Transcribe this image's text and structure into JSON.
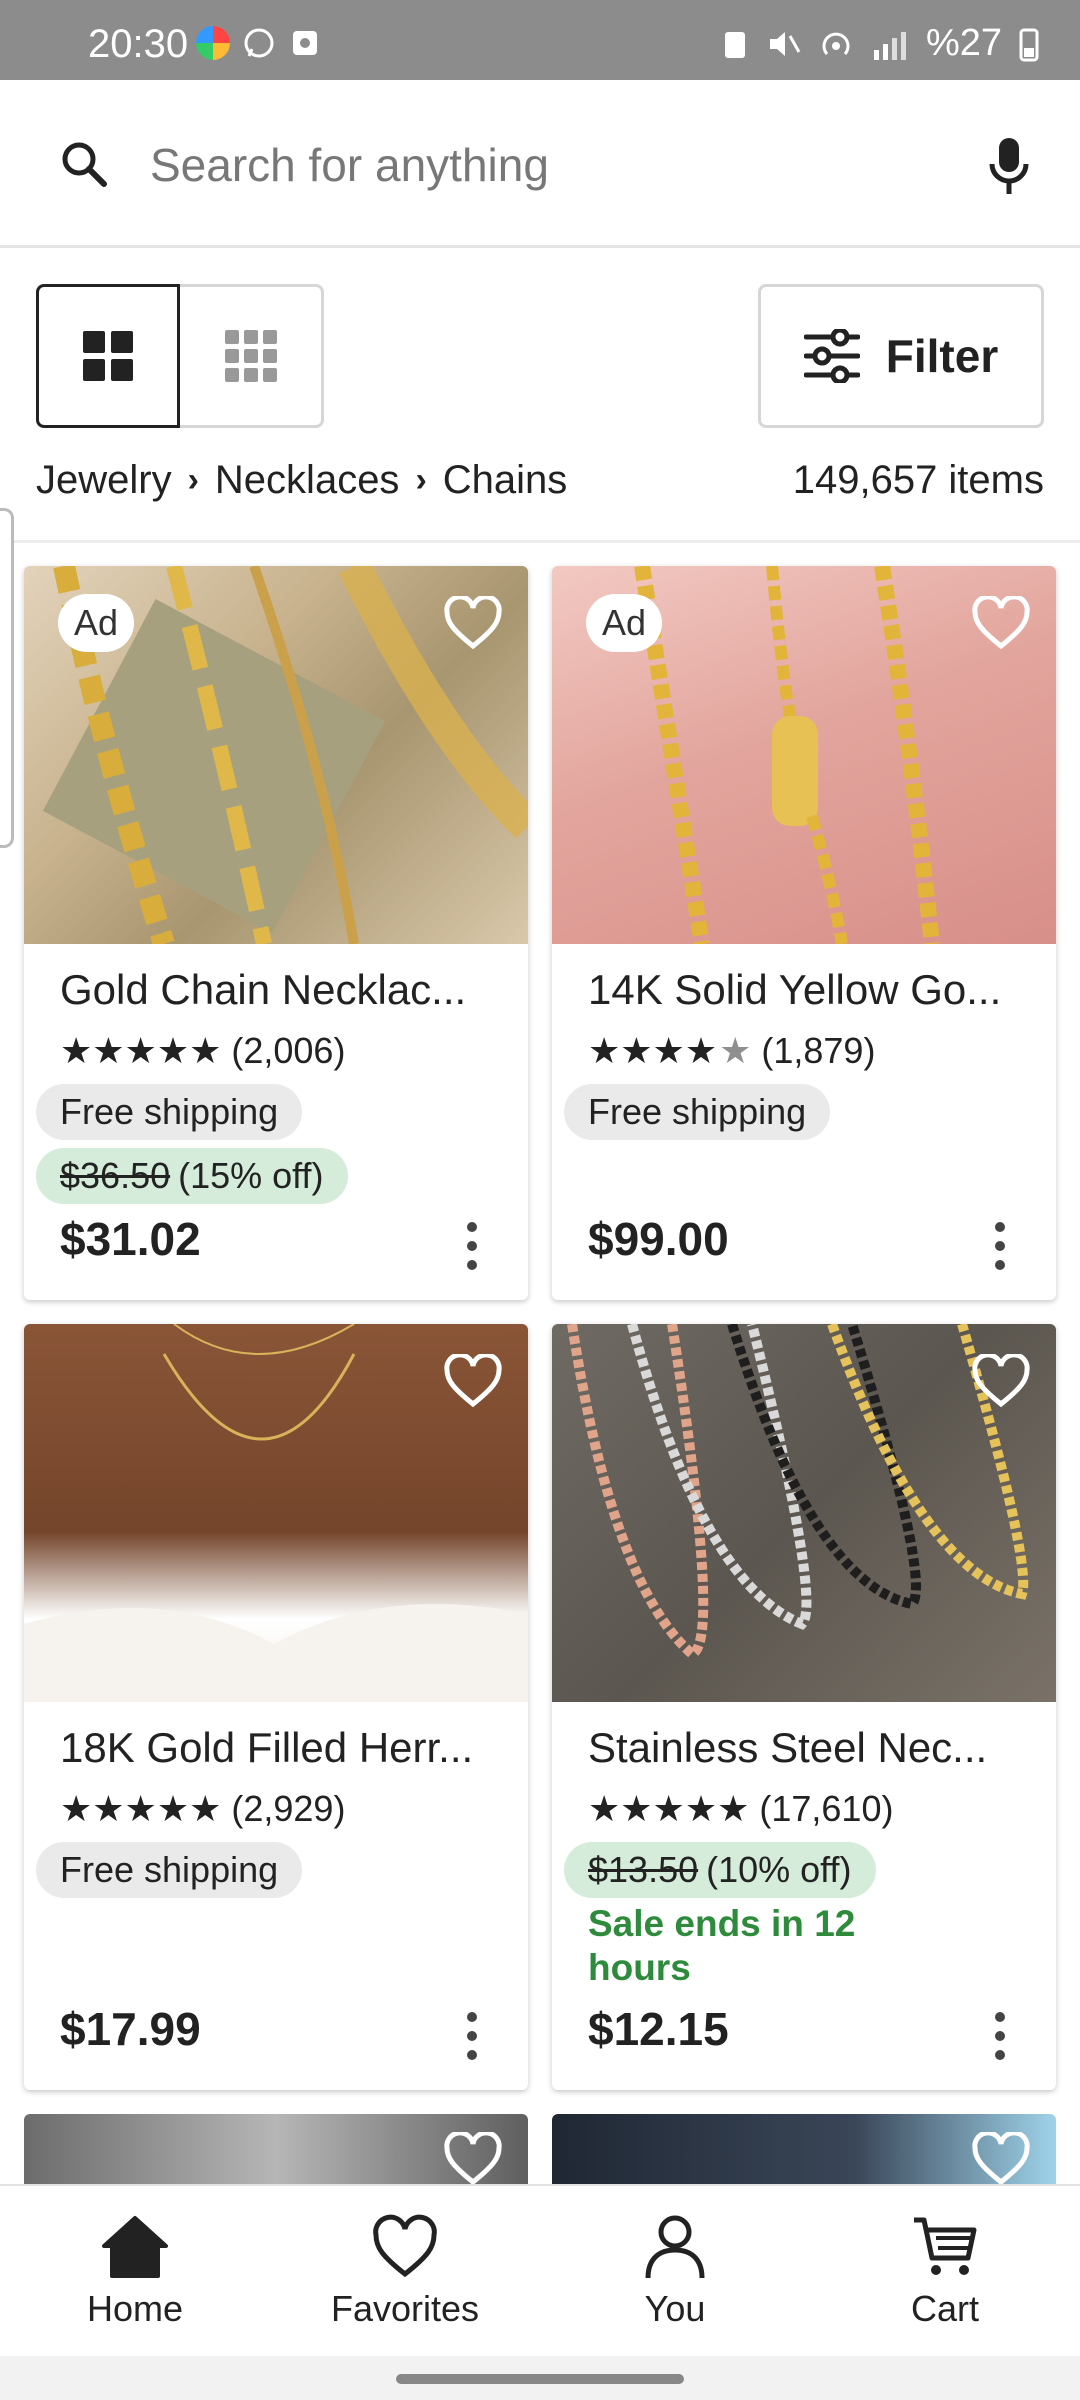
{
  "status_bar": {
    "time": "20:30",
    "battery": "%27"
  },
  "search": {
    "placeholder": "Search for anything"
  },
  "view_controls": {
    "filter_label": "Filter"
  },
  "breadcrumb": {
    "items": [
      "Jewelry",
      "Necklaces",
      "Chains"
    ],
    "item_count": "149,657 items"
  },
  "listings": [
    {
      "ad": "Ad",
      "title": "Gold Chain Necklac...",
      "rating_stars": 5,
      "reviews": "(2,006)",
      "shipping": "Free shipping",
      "original_price": "$36.50",
      "discount": "(15% off)",
      "price": "$31.02"
    },
    {
      "ad": "Ad",
      "title": "14K Solid Yellow Go...",
      "rating_stars": 4.5,
      "reviews": "(1,879)",
      "shipping": "Free shipping",
      "price": "$99.00"
    },
    {
      "title": "18K Gold Filled Herr...",
      "rating_stars": 5,
      "reviews": "(2,929)",
      "shipping": "Free shipping",
      "price": "$17.99"
    },
    {
      "title": "Stainless Steel Nec...",
      "rating_stars": 5,
      "reviews": "(17,610)",
      "original_price": "$13.50",
      "discount": "(10% off)",
      "sale_text": "Sale ends in 12 hours",
      "price": "$12.15"
    }
  ],
  "bottom_nav": {
    "home": "Home",
    "favorites": "Favorites",
    "you": "You",
    "cart": "Cart"
  },
  "colors": {
    "sale_green": "#2e8b3c",
    "discount_bg": "#d4ecd9",
    "pill_bg": "#eaeaea"
  }
}
